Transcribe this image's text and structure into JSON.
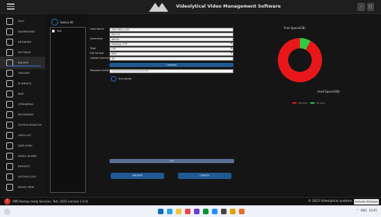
{
  "window": {
    "title": "Videolytical Video Management Software"
  },
  "sidebar": {
    "items": [
      {
        "label": "TEST",
        "icon": "page-icon"
      },
      {
        "label": "DASHBOARD",
        "icon": "camera-icon"
      },
      {
        "label": "NETWORK",
        "icon": "search-icon"
      },
      {
        "label": "SETTINGS",
        "icon": "gear-icon"
      },
      {
        "label": "BACKUP",
        "icon": "backup-icon"
      },
      {
        "label": "TRIGGER",
        "icon": "arrow-icon"
      },
      {
        "label": "PLAYBACK",
        "icon": "document-icon"
      },
      {
        "label": "MAP",
        "icon": "location-icon"
      },
      {
        "label": "STREAMING",
        "icon": "play-icon"
      },
      {
        "label": "RECORDING",
        "icon": "record-icon"
      },
      {
        "label": "SYSTEM MONITOR",
        "icon": "monitor-icon"
      },
      {
        "label": "USER LIST",
        "icon": "user-icon"
      },
      {
        "label": "DATA SYNC",
        "icon": "sync-icon"
      },
      {
        "label": "AUDIO ALARM",
        "icon": "alarm-icon"
      },
      {
        "label": "REPORTS",
        "icon": "report-icon"
      },
      {
        "label": "SYSTEM LOGS",
        "icon": "logs-icon"
      },
      {
        "label": "IMAGE VIEW",
        "icon": "image-icon"
      }
    ]
  },
  "list_panel": {
    "header": "Select All",
    "rows": [
      "Test"
    ]
  },
  "form": {
    "fields": [
      {
        "label": "Host Name",
        "value": "192.168.1.100"
      },
      {
        "label": "",
        "value": "Port 21"
      },
      {
        "label": "Username",
        "value": "admin"
      },
      {
        "label": "",
        "value": "Protocol: FTP"
      },
      {
        "label": "Type",
        "value": "FTP"
      },
      {
        "label": "File Format",
        "value": "MP4"
      },
      {
        "label": "Upload Interval",
        "value": "30"
      }
    ],
    "connect_button": "Connect",
    "password_label": "Password Setting",
    "password_value": "••••••••••••••••••••••••••",
    "encryption_label": "Encryption"
  },
  "progress": {
    "percent_text": "0%",
    "value": 0
  },
  "actions": {
    "backup_button": "BACKUP",
    "cancel_button": "CANCEL"
  },
  "chart_data": {
    "type": "pie",
    "style": "donut",
    "slices": [
      {
        "name": "Free Space",
        "value": 8,
        "label": "Free Space(GB)",
        "color": "#2ecc40"
      },
      {
        "name": "Used Space",
        "value": 92,
        "label": "Used Space(GB)",
        "color": "#e8181a"
      }
    ],
    "legend_position": "bottom"
  },
  "status": {
    "left_text": "VMS Backup ready Services, Test, 2023 (version 1.0.0)",
    "right_text": "© 2023 Videolytical systems",
    "badge": "Activate Windows"
  },
  "taskbar": {
    "app_colors": [
      "#0f6cbd",
      "#2aa0ea",
      "#f0c33c",
      "#e74856",
      "#6b3fd1",
      "#0a8f3f",
      "#1e90ff",
      "#444444",
      "#e0a100",
      "#e66d2c"
    ],
    "tray_lang": "ENG",
    "tray_time": "10:45"
  }
}
